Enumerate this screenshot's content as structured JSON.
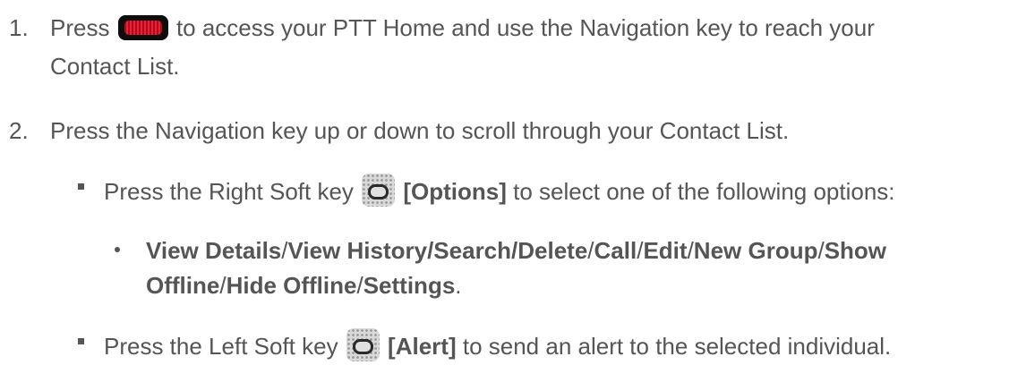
{
  "steps": [
    {
      "number": "1.",
      "before": "Press",
      "after": "to access your PTT Home and use the Navigation key to reach your",
      "cont": "Contact List."
    },
    {
      "number": "2.",
      "text": "Press the Navigation key up or down to scroll through your Contact List."
    }
  ],
  "bullets": {
    "options": {
      "before": "Press the Right Soft key",
      "label": "[Options]",
      "after": "to select one of the following options:"
    },
    "sub": {
      "l1": [
        "View Details",
        "/",
        "View History/Search/Delete",
        "/",
        "Call",
        "/",
        "Edit",
        "/",
        "New Group",
        "/",
        "Show"
      ],
      "l2": [
        "Offline",
        "/",
        "Hide Offline",
        "/",
        "Settings",
        "."
      ]
    },
    "alert": {
      "before": "Press the Left Soft key",
      "label": "[Alert]",
      "after": "to send an alert to the selected individual."
    }
  },
  "icons": {
    "ptt_key": "ptt-key-icon",
    "right_soft_key": "right-soft-key-icon",
    "left_soft_key": "left-soft-key-icon"
  },
  "colors": {
    "text": "#555555",
    "ptt_red": "#e62236"
  }
}
